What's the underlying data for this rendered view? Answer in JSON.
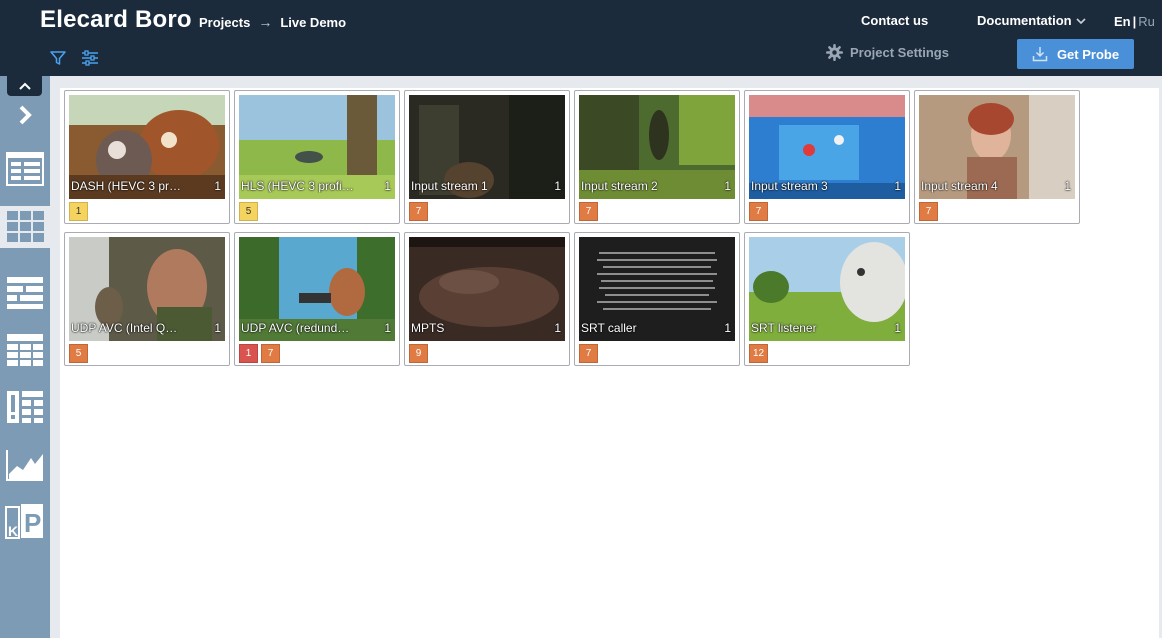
{
  "header": {
    "brand": "Elecard Boro",
    "crumb_projects": "Projects",
    "crumb_arrow": "→",
    "crumb_current": "Live Demo",
    "contact": "Contact us",
    "documentation": "Documentation",
    "lang_en": "En",
    "lang_sep": "|",
    "lang_ru": "Ru",
    "settings_label": "Project Settings",
    "probe_label": "Get Probe"
  },
  "sidebar": {
    "items": [
      {
        "name": "arrow-right",
        "active": false
      },
      {
        "name": "layout-list",
        "active": false
      },
      {
        "name": "layout-grid",
        "active": true
      },
      {
        "name": "layout-detail",
        "active": false
      },
      {
        "name": "table",
        "active": false
      },
      {
        "name": "alerts-table",
        "active": false
      },
      {
        "name": "chart",
        "active": false
      },
      {
        "name": "kpi",
        "active": false
      }
    ]
  },
  "tiles": [
    {
      "name": "DASH (HEVC 3 pr…",
      "count": "1",
      "scene": "animals",
      "badges": [
        {
          "text": "1",
          "type": "warn"
        }
      ]
    },
    {
      "name": "HLS (HEVC 3 profi…",
      "count": "1",
      "scene": "meadow",
      "badges": [
        {
          "text": "5",
          "type": "warn"
        }
      ]
    },
    {
      "name": "Input stream 1",
      "count": "1",
      "scene": "dark",
      "badges": [
        {
          "text": "7",
          "type": "orange"
        }
      ]
    },
    {
      "name": "Input stream 2",
      "count": "1",
      "scene": "forest",
      "badges": [
        {
          "text": "7",
          "type": "orange"
        }
      ]
    },
    {
      "name": "Input stream 3",
      "count": "1",
      "scene": "crowd",
      "badges": [
        {
          "text": "7",
          "type": "orange"
        }
      ]
    },
    {
      "name": "Input stream 4",
      "count": "1",
      "scene": "woman",
      "badges": [
        {
          "text": "7",
          "type": "orange"
        }
      ]
    },
    {
      "name": "UDP AVC (Intel Q…",
      "count": "1",
      "scene": "giant",
      "badges": [
        {
          "text": "5",
          "type": "orange"
        }
      ]
    },
    {
      "name": "UDP AVC (redund…",
      "count": "1",
      "scene": "jungle",
      "badges": [
        {
          "text": "1",
          "type": "red"
        },
        {
          "text": "7",
          "type": "orange"
        }
      ]
    },
    {
      "name": "MPTS",
      "count": "1",
      "scene": "rock",
      "badges": [
        {
          "text": "9",
          "type": "orange"
        }
      ]
    },
    {
      "name": "SRT caller",
      "count": "1",
      "scene": "text",
      "badges": [
        {
          "text": "7",
          "type": "orange"
        }
      ]
    },
    {
      "name": "SRT listener",
      "count": "1",
      "scene": "bunny",
      "badges": [
        {
          "text": "12",
          "type": "orange"
        }
      ]
    }
  ],
  "colors": {
    "header_bg": "#1c2b3b",
    "sidebar_bg": "#7e9bb6",
    "probe_bg": "#4a90d9",
    "badge_warn": "#f4d35e",
    "badge_orange": "#e07b44",
    "badge_red": "#d9534f"
  }
}
